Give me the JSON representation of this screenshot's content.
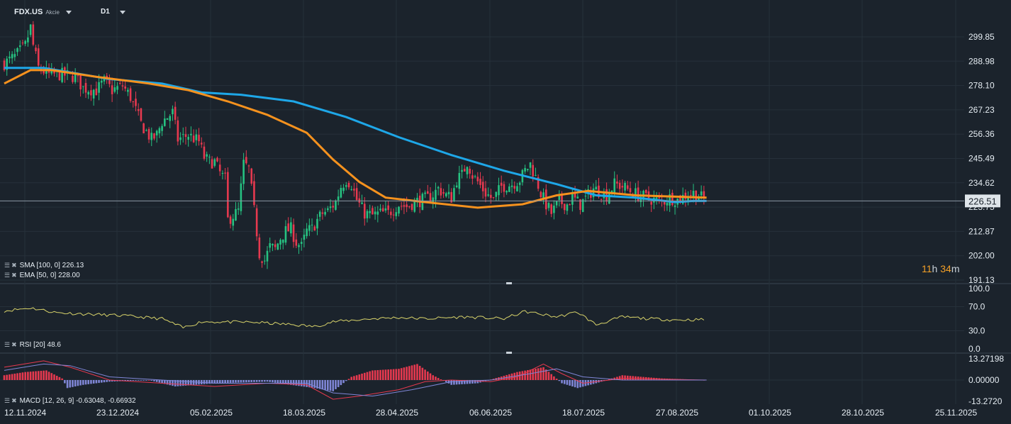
{
  "header": {
    "symbol": "FDX.US",
    "symbol_sub": "Akcie",
    "timeframe": "D1"
  },
  "indicators": {
    "sma": "SMA [100, 0] 226.13",
    "ema": "EMA [50, 0] 228.00",
    "rsi": "RSI [20] 48.6",
    "macd": "MACD [12, 26, 9] -0.63048, -0.66932"
  },
  "countdown": {
    "hours": "11",
    "h_unit": "h",
    "minutes": "34",
    "m_unit": "m"
  },
  "colors": {
    "background": "#1b232c",
    "grid": "#26303a",
    "up_candle": "#26c281",
    "down_candle": "#e6394f",
    "sma_line": "#1ea7e8",
    "ema_line": "#f6921e",
    "rsi_line": "#d8d36a",
    "macd_pos": "#e6394f",
    "macd_neg": "#7f86d6",
    "macd_line": "#e6394f",
    "signal_line": "#7f86d6"
  },
  "chart_data": {
    "type": "candlestick",
    "price_axis": {
      "ticks": [
        299.85,
        288.98,
        278.1,
        267.23,
        256.36,
        245.49,
        234.62,
        223.75,
        212.87,
        202.0,
        191.13
      ],
      "tick_labels": [
        "299.85",
        "288.98",
        "278.10",
        "267.23",
        "256.36",
        "245.49",
        "234.62",
        "223.75",
        "212.87",
        "202.00",
        "191.13"
      ],
      "current_price": 226.51,
      "current_price_label": "226.51",
      "ylim": [
        191.13,
        307
      ]
    },
    "x_axis": {
      "tick_labels": [
        "12.11.2024",
        "23.12.2024",
        "05.02.2025",
        "18.03.2025",
        "28.04.2025",
        "06.06.2025",
        "18.07.2025",
        "27.08.2025",
        "01.10.2025",
        "28.10.2025",
        "25.11.2025"
      ]
    },
    "close_path": [
      [
        0,
        288
      ],
      [
        4,
        291
      ],
      [
        8,
        296
      ],
      [
        10,
        304
      ],
      [
        11,
        296
      ],
      [
        13,
        286
      ],
      [
        17,
        283
      ],
      [
        22,
        283
      ],
      [
        27,
        282
      ],
      [
        30,
        277
      ],
      [
        35,
        276
      ],
      [
        38,
        280
      ],
      [
        41,
        276
      ],
      [
        45,
        278
      ],
      [
        48,
        273
      ],
      [
        52,
        261
      ],
      [
        56,
        254
      ],
      [
        58,
        256
      ],
      [
        60,
        262
      ],
      [
        64,
        266
      ],
      [
        66,
        254
      ],
      [
        70,
        256
      ],
      [
        74,
        253
      ],
      [
        76,
        246
      ],
      [
        78,
        244
      ],
      [
        80,
        244
      ],
      [
        82,
        239
      ],
      [
        84,
        236
      ],
      [
        85,
        218
      ],
      [
        89,
        222
      ],
      [
        91,
        243
      ],
      [
        93,
        241
      ],
      [
        95,
        222
      ],
      [
        97,
        203
      ],
      [
        99,
        200
      ],
      [
        101,
        206
      ],
      [
        103,
        205
      ],
      [
        105,
        210
      ],
      [
        107,
        213
      ],
      [
        109,
        214
      ],
      [
        111,
        208
      ],
      [
        113,
        206
      ],
      [
        115,
        213
      ],
      [
        117,
        214
      ],
      [
        119,
        218
      ],
      [
        121,
        221
      ],
      [
        123,
        222
      ],
      [
        126,
        226
      ],
      [
        128,
        233
      ],
      [
        130,
        236
      ],
      [
        132,
        234
      ],
      [
        134,
        227
      ],
      [
        137,
        221
      ],
      [
        140,
        220
      ],
      [
        143,
        221
      ],
      [
        146,
        221
      ],
      [
        150,
        225
      ],
      [
        153,
        224
      ],
      [
        156,
        226
      ],
      [
        159,
        227
      ],
      [
        162,
        228
      ],
      [
        165,
        232
      ],
      [
        168,
        229
      ],
      [
        170,
        228
      ],
      [
        172,
        236
      ],
      [
        174,
        238
      ],
      [
        176,
        244
      ],
      [
        178,
        238
      ],
      [
        180,
        235
      ],
      [
        183,
        230
      ],
      [
        186,
        227
      ],
      [
        189,
        233
      ],
      [
        193,
        234
      ],
      [
        196,
        236
      ],
      [
        198,
        240
      ],
      [
        200,
        243
      ],
      [
        202,
        237
      ],
      [
        204,
        230
      ],
      [
        206,
        225
      ],
      [
        208,
        221
      ],
      [
        211,
        226
      ],
      [
        214,
        225
      ],
      [
        216,
        228
      ],
      [
        219,
        225
      ],
      [
        222,
        229
      ],
      [
        224,
        232
      ],
      [
        226,
        231
      ],
      [
        229,
        229
      ],
      [
        232,
        234
      ],
      [
        235,
        233
      ],
      [
        238,
        231
      ],
      [
        241,
        229
      ],
      [
        244,
        228
      ],
      [
        247,
        227
      ],
      [
        250,
        226
      ],
      [
        253,
        228
      ],
      [
        256,
        227
      ],
      [
        259,
        229
      ],
      [
        262,
        230
      ],
      [
        265,
        228
      ],
      [
        267,
        226.5
      ]
    ],
    "sma": {
      "name": "SMA [100, 0]",
      "value": 226.13,
      "path": [
        [
          0,
          286
        ],
        [
          15,
          286
        ],
        [
          40,
          281
        ],
        [
          60,
          279
        ],
        [
          75,
          275
        ],
        [
          90,
          274
        ],
        [
          110,
          271
        ],
        [
          130,
          264
        ],
        [
          150,
          255
        ],
        [
          170,
          247
        ],
        [
          190,
          240
        ],
        [
          210,
          234
        ],
        [
          225,
          229
        ],
        [
          240,
          228
        ],
        [
          255,
          226
        ],
        [
          262,
          226.5
        ],
        [
          267,
          226.5
        ]
      ]
    },
    "ema": {
      "name": "EMA [50, 0]",
      "value": 228.0,
      "path": [
        [
          0,
          279
        ],
        [
          10,
          285
        ],
        [
          18,
          285
        ],
        [
          35,
          282
        ],
        [
          55,
          279
        ],
        [
          70,
          276
        ],
        [
          85,
          271
        ],
        [
          100,
          265
        ],
        [
          115,
          257
        ],
        [
          125,
          245
        ],
        [
          135,
          235
        ],
        [
          145,
          228
        ],
        [
          160,
          226
        ],
        [
          180,
          223.5
        ],
        [
          197,
          225
        ],
        [
          210,
          229
        ],
        [
          222,
          231
        ],
        [
          240,
          229
        ],
        [
          267,
          228
        ]
      ]
    },
    "rsi": {
      "name": "RSI [20]",
      "value": 48.6,
      "ticks": [
        100.0,
        70.0,
        30.0,
        0.0
      ],
      "tick_labels": [
        "100.0",
        "70.0",
        "30.0",
        "0.0"
      ],
      "path": [
        [
          0,
          63
        ],
        [
          10,
          68
        ],
        [
          20,
          60
        ],
        [
          30,
          58
        ],
        [
          45,
          55
        ],
        [
          60,
          50
        ],
        [
          68,
          35
        ],
        [
          75,
          45
        ],
        [
          95,
          44
        ],
        [
          110,
          40
        ],
        [
          118,
          37
        ],
        [
          125,
          45
        ],
        [
          140,
          50
        ],
        [
          150,
          52
        ],
        [
          160,
          50
        ],
        [
          175,
          53
        ],
        [
          190,
          50
        ],
        [
          198,
          62
        ],
        [
          210,
          53
        ],
        [
          218,
          61
        ],
        [
          225,
          40
        ],
        [
          235,
          53
        ],
        [
          245,
          50
        ],
        [
          255,
          48
        ],
        [
          267,
          48.6
        ]
      ]
    },
    "macd": {
      "name": "MACD [12, 26, 9]",
      "values": [
        -0.63048,
        -0.66932
      ],
      "ticks": [
        13.27198,
        0.0,
        -13.272
      ],
      "tick_labels": [
        "13.27198",
        "0.00000",
        "-13.2720"
      ],
      "hist": [
        [
          0,
          3
        ],
        [
          8,
          5
        ],
        [
          16,
          6
        ],
        [
          22,
          1
        ],
        [
          24,
          -5
        ],
        [
          30,
          -3
        ],
        [
          40,
          -1
        ],
        [
          55,
          0
        ],
        [
          65,
          -4
        ],
        [
          80,
          -2
        ],
        [
          100,
          -1
        ],
        [
          118,
          -5
        ],
        [
          125,
          -7
        ],
        [
          132,
          2
        ],
        [
          140,
          6
        ],
        [
          150,
          7
        ],
        [
          157,
          10
        ],
        [
          163,
          3
        ],
        [
          170,
          -3
        ],
        [
          180,
          -2
        ],
        [
          195,
          5
        ],
        [
          205,
          8
        ],
        [
          212,
          -2
        ],
        [
          218,
          -5
        ],
        [
          225,
          -2
        ],
        [
          235,
          3
        ],
        [
          250,
          1
        ],
        [
          267,
          0
        ]
      ],
      "macd_line": [
        [
          0,
          8
        ],
        [
          15,
          12
        ],
        [
          25,
          8
        ],
        [
          40,
          0
        ],
        [
          60,
          -2
        ],
        [
          80,
          -4
        ],
        [
          100,
          -2
        ],
        [
          115,
          -3
        ],
        [
          125,
          -12
        ],
        [
          135,
          -10
        ],
        [
          150,
          -6
        ],
        [
          160,
          -1
        ],
        [
          170,
          0
        ],
        [
          185,
          -1
        ],
        [
          195,
          2
        ],
        [
          205,
          10
        ],
        [
          212,
          4
        ],
        [
          220,
          -2
        ],
        [
          235,
          1
        ],
        [
          267,
          0
        ]
      ],
      "signal_line": [
        [
          0,
          6
        ],
        [
          15,
          10
        ],
        [
          25,
          9
        ],
        [
          40,
          2
        ],
        [
          60,
          0
        ],
        [
          80,
          -2
        ],
        [
          100,
          -2
        ],
        [
          115,
          -2
        ],
        [
          125,
          -8
        ],
        [
          140,
          -10
        ],
        [
          155,
          -6
        ],
        [
          170,
          -1
        ],
        [
          185,
          0
        ],
        [
          200,
          4
        ],
        [
          210,
          7
        ],
        [
          220,
          2
        ],
        [
          235,
          0
        ],
        [
          267,
          0
        ]
      ]
    }
  }
}
